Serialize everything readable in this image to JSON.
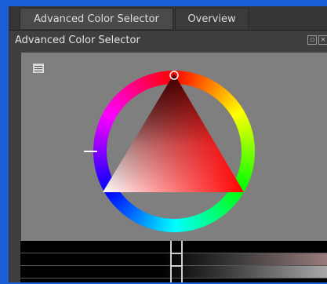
{
  "tabs": [
    {
      "label": "Advanced Color Selector",
      "active": true
    },
    {
      "label": "Overview",
      "active": false
    }
  ],
  "dock_title": "Advanced Color Selector",
  "icons": {
    "settings": "settings-icon",
    "float": "float-docker-icon",
    "close": "close-docker-icon"
  },
  "colors": {
    "current_hue": "#ff0000",
    "panel_bg": "#7f7f7f"
  }
}
